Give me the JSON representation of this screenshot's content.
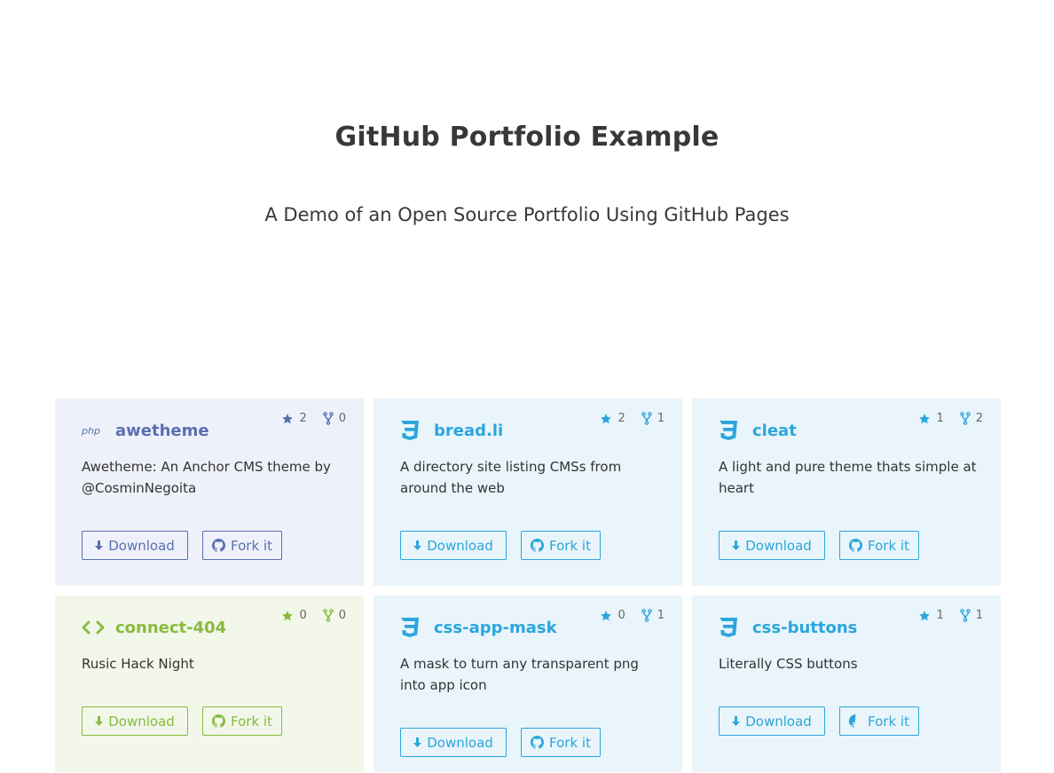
{
  "header": {
    "title": "GitHub Portfolio Example",
    "subtitle": "A Demo of an Open Source Portfolio Using GitHub Pages"
  },
  "buttons": {
    "download_label": "Download",
    "fork_label": "Fork it"
  },
  "colors": {
    "php_accent": "#5a6fb0",
    "css_accent": "#2ba6dc",
    "html_accent": "#88bb3c"
  },
  "repos": [
    {
      "name": "awetheme",
      "description": "Awetheme: An Anchor CMS theme by @CosminNegoita",
      "stars": "2",
      "forks": "0",
      "language_icon": "php-icon"
    },
    {
      "name": "bread.li",
      "description": "A directory site listing CMSs from around the web",
      "stars": "2",
      "forks": "1",
      "language_icon": "css3-icon"
    },
    {
      "name": "cleat",
      "description": "A light and pure theme thats simple at heart",
      "stars": "1",
      "forks": "2",
      "language_icon": "css3-icon"
    },
    {
      "name": "connect-404",
      "description": "Rusic Hack Night",
      "stars": "0",
      "forks": "0",
      "language_icon": "code-icon"
    },
    {
      "name": "css-app-mask",
      "description": "A mask to turn any transparent png into app icon",
      "stars": "0",
      "forks": "1",
      "language_icon": "css3-icon"
    },
    {
      "name": "css-buttons",
      "description": "Literally CSS buttons",
      "stars": "1",
      "forks": "1",
      "language_icon": "css3-icon"
    }
  ]
}
